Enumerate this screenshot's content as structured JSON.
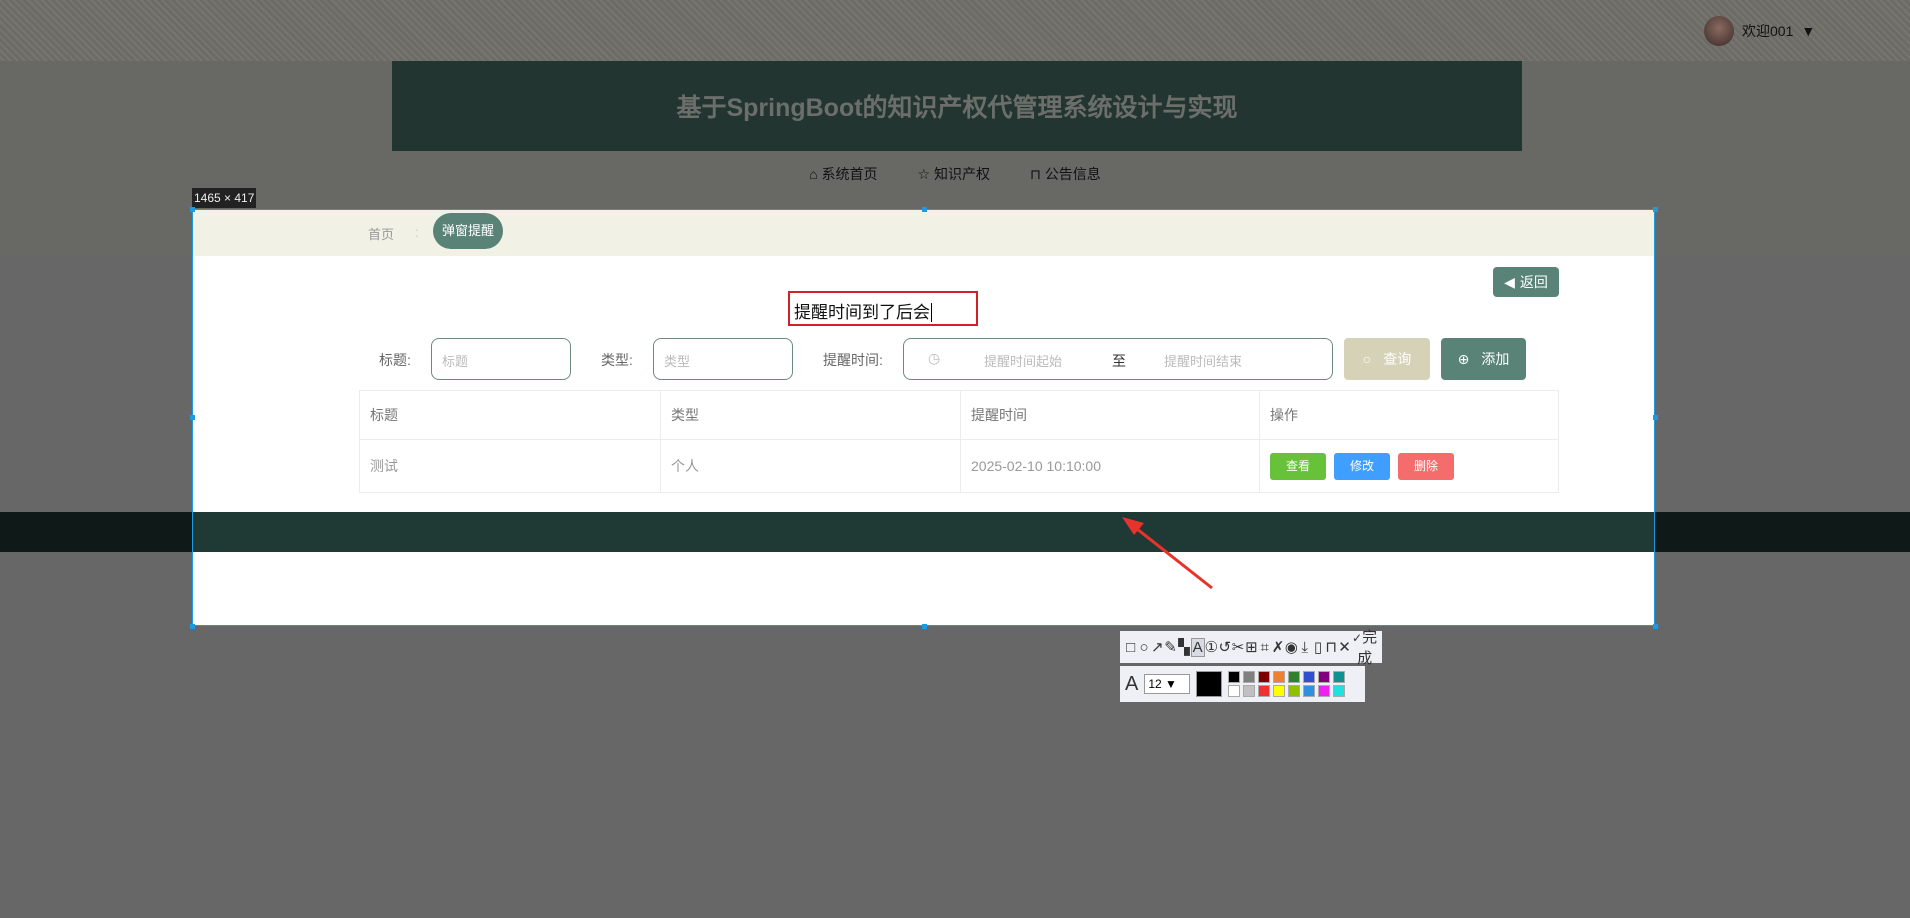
{
  "header": {
    "welcome": "欢迎001",
    "title": "基于SpringBoot的知识产权代管理系统设计与实现"
  },
  "nav": [
    {
      "icon": "home-icon",
      "label": "系统首页"
    },
    {
      "icon": "star-icon",
      "label": "知识产权"
    },
    {
      "icon": "bag-icon",
      "label": "公告信息"
    }
  ],
  "capture": {
    "size_label": "1465 × 417",
    "annotation_text": "提醒时间到了后会"
  },
  "breadcrumb": {
    "home": "首页",
    "separator": ":",
    "current": "弹窗提醒"
  },
  "back_label": "返回",
  "search": {
    "title_label": "标题:",
    "title_placeholder": "标题",
    "type_label": "类型:",
    "type_placeholder": "类型",
    "time_label": "提醒时间:",
    "start_placeholder": "提醒时间起始",
    "range_sep": "至",
    "end_placeholder": "提醒时间结束",
    "query_label": "查询",
    "add_label": "添加"
  },
  "table": {
    "headers": [
      "标题",
      "类型",
      "提醒时间",
      "操作"
    ],
    "rows": [
      {
        "title": "测试",
        "type": "个人",
        "time": "2025-02-10 10:10:00",
        "actions": [
          "查看",
          "修改",
          "删除"
        ]
      }
    ]
  },
  "toolbar": {
    "done_label": "完成",
    "font_size": "12",
    "colors": [
      "#000000",
      "#808080",
      "#800000",
      "#f08030",
      "#308030",
      "#3050d0",
      "#800080",
      "#109090",
      "#ffffff",
      "#c0c0c0",
      "#f03030",
      "#ffff00",
      "#90c000",
      "#3090e0",
      "#f020f0",
      "#20e0e0"
    ]
  }
}
